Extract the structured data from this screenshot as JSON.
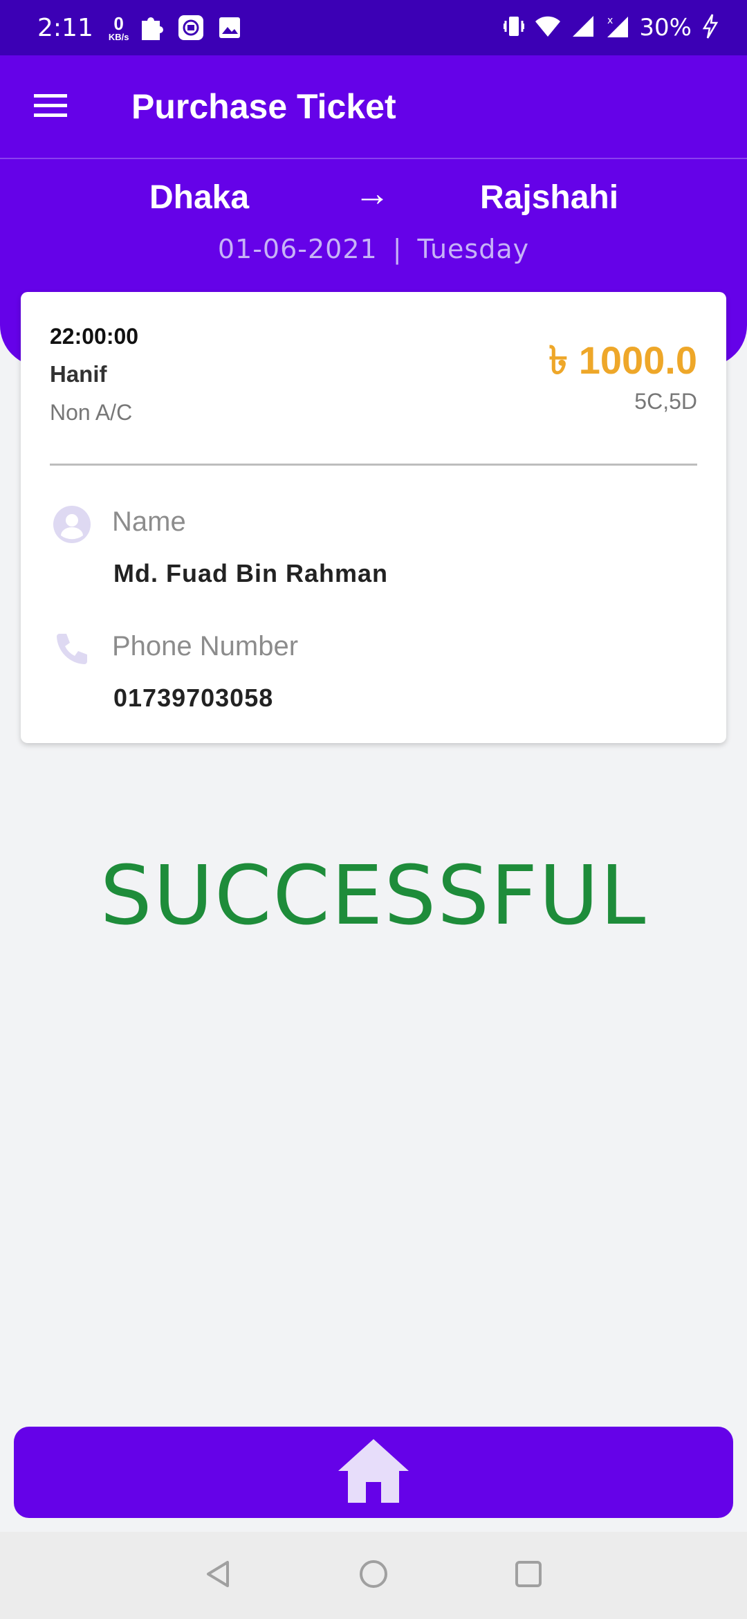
{
  "status_bar": {
    "time": "2:11",
    "net_speed_value": "0",
    "net_speed_unit": "KB/s",
    "battery": "30%",
    "icons": [
      "puzzle-icon",
      "sync-icon",
      "image-icon",
      "vibrate-icon",
      "wifi-icon",
      "signal-icon",
      "signal-no-data-icon",
      "charging-icon"
    ]
  },
  "app_bar": {
    "title": "Purchase Ticket",
    "menu_icon": "hamburger-menu-icon"
  },
  "route": {
    "from": "Dhaka",
    "arrow": "→",
    "to": "Rajshahi",
    "date": "01-06-2021",
    "separator": "|",
    "day": "Tuesday"
  },
  "ticket": {
    "departure_time": "22:00:00",
    "operator": "Hanif",
    "coach_type": "Non A/C",
    "price": "৳ 1000.0",
    "seats": "5C,5D",
    "name_label": "Name",
    "name_value": "Md. Fuad Bin Rahman",
    "phone_label": "Phone Number",
    "phone_value": "01739703058"
  },
  "status_message": "SUCCESSFUL",
  "home_button_icon": "home-icon",
  "colors": {
    "primary": "#6502e8",
    "status_bar": "#3c00b5",
    "price": "#eea729",
    "success": "#1e8c3a",
    "background": "#f2f3f5"
  }
}
